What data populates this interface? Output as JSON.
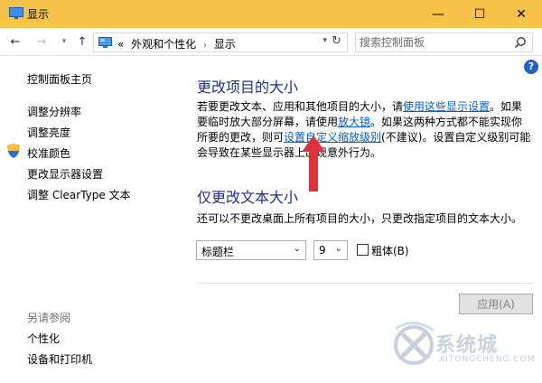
{
  "window": {
    "title": "显示",
    "minimize_glyph": "—",
    "maximize_glyph": "☐",
    "close_glyph": "✕"
  },
  "nav": {
    "back_glyph": "←",
    "forward_glyph": "→",
    "recent_glyph": "▾",
    "up_glyph": "↑"
  },
  "address": {
    "overflow": "«",
    "crumbs": [
      "外观和个性化",
      "显示"
    ],
    "separator": "›",
    "dropdown_glyph": "▾",
    "refresh_glyph": "↻"
  },
  "search": {
    "placeholder": "搜索控制面板",
    "value": ""
  },
  "help_glyph": "?",
  "sidebar": {
    "home": "控制面板主页",
    "items": [
      "调整分辨率",
      "调整亮度",
      "校准颜色",
      "更改显示器设置",
      "调整 ClearType 文本"
    ],
    "see_also_title": "另请参阅",
    "see_also": [
      "个性化",
      "设备和打印机"
    ]
  },
  "main": {
    "section1_title": "更改项目的大小",
    "para1_parts": [
      "若要更改文本、应用和其他项目的大小，请",
      "使用这些显示设置",
      "。如果要临时放大部分屏幕，请使用",
      "放大镜",
      "。如果这两种方式都不能实现你所要的更改，则可",
      "设置自定义缩放级别",
      "(不建议)。设置自定义级别可能会导致在某些显示器上出现意外行为。"
    ],
    "section2_title": "仅更改文本大小",
    "para2": "还可以不更改桌面上所有项目的大小，只更改指定项目的文本大小。",
    "element_select": "标题栏",
    "size_select": "9",
    "select_arrow": "⌄",
    "bold_label": "粗体(B)",
    "bold_checked": false,
    "apply_label": "应用(A)"
  },
  "watermark": {
    "brand": "系统城",
    "url": "XITONGCHENG.COM"
  },
  "colors": {
    "titlebar": "#f6c24a",
    "heading": "#1e3287",
    "link": "#0a5fbf",
    "annotation_arrow": "#e0303a"
  }
}
